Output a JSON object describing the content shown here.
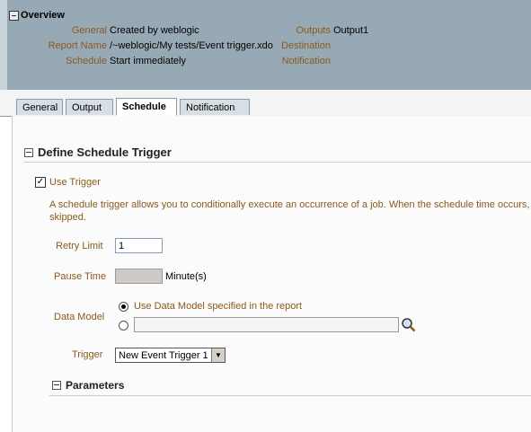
{
  "overview": {
    "title": "Overview",
    "general_label": "General",
    "general_value": "Created by weblogic",
    "report_name_label": "Report Name",
    "report_name_value": "/~weblogic/My tests/Event trigger.xdo",
    "schedule_label": "Schedule",
    "schedule_value": "Start immediately",
    "outputs_label": "Outputs",
    "outputs_value": "Output1",
    "destination_label": "Destination",
    "notification_label": "Notification"
  },
  "tabs": [
    {
      "label": "General"
    },
    {
      "label": "Output"
    },
    {
      "label": "Schedule",
      "active": true
    },
    {
      "label": "Notification"
    }
  ],
  "trigger_section": {
    "title": "Define Schedule Trigger",
    "use_trigger_label": "Use Trigger",
    "use_trigger_checked": true,
    "description_line1": "A schedule trigger allows you to conditionally execute an occurrence of a job. When the schedule time occurs, t",
    "description_line2": "skipped.",
    "retry_limit_label": "Retry Limit",
    "retry_limit_value": "1",
    "pause_time_label": "Pause Time",
    "pause_time_unit": "Minute(s)",
    "data_model_label": "Data Model",
    "data_model_option1": "Use Data Model specified in the report",
    "trigger_label": "Trigger",
    "trigger_value": "New Event Trigger 1",
    "parameters_title": "Parameters"
  },
  "colors": {
    "overview_bg": "#98a9b6",
    "label_brown": "#8a5a1a"
  }
}
